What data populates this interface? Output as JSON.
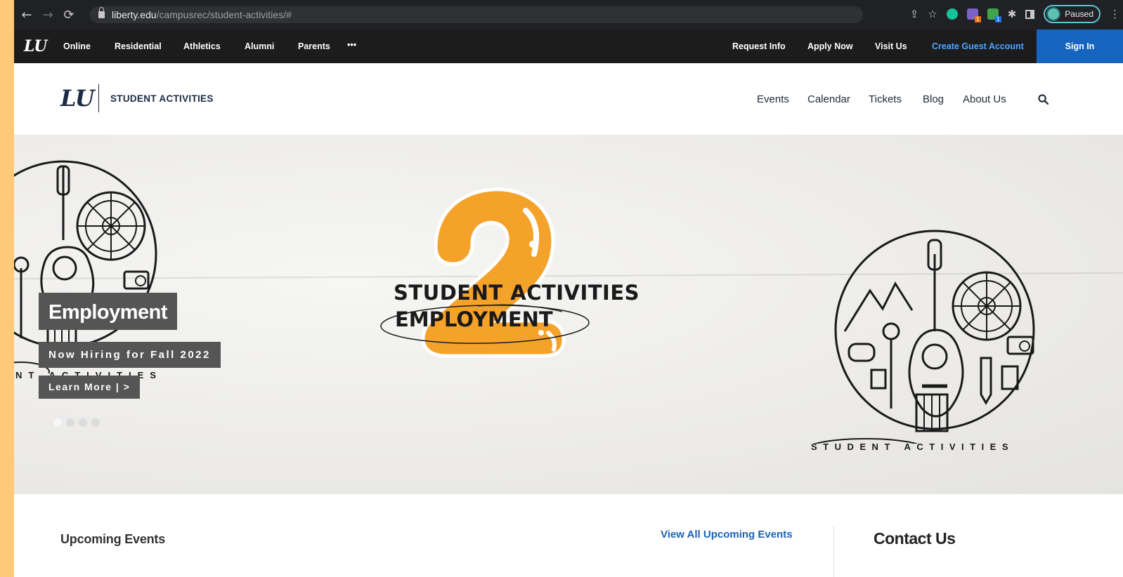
{
  "browser": {
    "url_host": "liberty.edu",
    "url_path": "/campusrec/student-activities/#",
    "profile_status": "Paused",
    "icons": [
      "back-arrow",
      "forward-arrow",
      "reload",
      "lock",
      "share",
      "star",
      "grammarly",
      "extension",
      "extension",
      "puzzle",
      "side-panel",
      "profile",
      "kebab-menu"
    ],
    "extension_badges": [
      "1",
      "1"
    ]
  },
  "global_nav": {
    "logo": "LU",
    "left_items": [
      "Online",
      "Residential",
      "Athletics",
      "Alumni",
      "Parents",
      "•••"
    ],
    "right_items": [
      "Request Info",
      "Apply Now",
      "Visit Us",
      "Create Guest Account"
    ],
    "sign_in": "Sign In"
  },
  "site_header": {
    "logo": "LU",
    "title": "STUDENT ACTIVITIES",
    "menu": [
      "Events",
      "Calendar",
      "Tickets",
      "Blog",
      "About Us"
    ],
    "search_icon": "search-icon"
  },
  "hero": {
    "overlay_number": "2",
    "center_line1": "STUDENT ACTIVITIES",
    "center_line2": "EMPLOYMENT",
    "slide_title": "Employment",
    "slide_subtitle": "Now Hiring for Fall 2022",
    "slide_cta": "Learn More | >",
    "partial_caption": "NT ACTIVITIES",
    "right_caption": "STUDENT ACTIVITIES",
    "dots_count": 4,
    "active_dot": 0
  },
  "sections": {
    "upcoming_events": "Upcoming Events",
    "view_all": "View All Upcoming Events",
    "contact": "Contact Us"
  },
  "colors": {
    "background": "#ffc97a",
    "nav_dark": "#1c1c1c",
    "sign_in_blue": "#1565c0",
    "link_blue": "#1b63b3",
    "accent_orange": "#f5a22a"
  }
}
